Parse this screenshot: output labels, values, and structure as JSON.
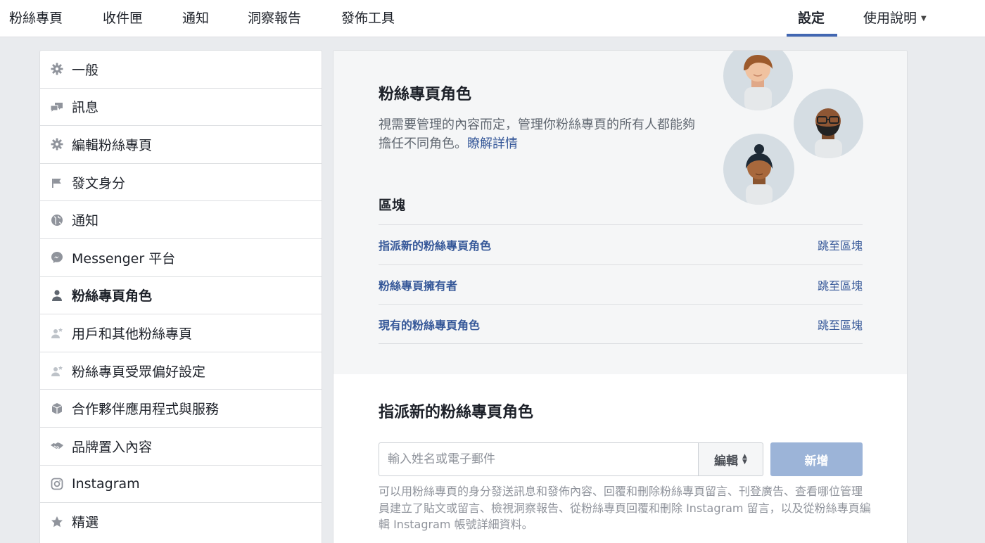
{
  "topnav": {
    "tabs": [
      "粉絲專頁",
      "收件匣",
      "通知",
      "洞察報告",
      "發佈工具"
    ],
    "settings": "設定",
    "help": "使用說明",
    "accent": "#4267b2"
  },
  "sidebar": {
    "items": [
      {
        "label": "一般",
        "icon": "gear-icon"
      },
      {
        "label": "訊息",
        "icon": "chat-bubbles-icon"
      },
      {
        "label": "編輯粉絲專頁",
        "icon": "gear-icon"
      },
      {
        "label": "發文身分",
        "icon": "flag-icon"
      },
      {
        "label": "通知",
        "icon": "globe-icon"
      },
      {
        "label": "Messenger 平台",
        "icon": "messenger-icon"
      },
      {
        "label": "粉絲專頁角色",
        "icon": "person-icon",
        "active": true
      },
      {
        "label": "用戶和其他粉絲專頁",
        "icon": "person-star-icon"
      },
      {
        "label": "粉絲專頁受眾偏好設定",
        "icon": "person-star-icon"
      },
      {
        "label": "合作夥伴應用程式與服務",
        "icon": "cube-icon"
      },
      {
        "label": "品牌置入內容",
        "icon": "handshake-icon"
      },
      {
        "label": "Instagram",
        "icon": "instagram-icon"
      },
      {
        "label": "精選",
        "icon": "star-icon"
      }
    ]
  },
  "hero": {
    "title": "粉絲專頁角色",
    "desc": "視需要管理的內容而定，管理你粉絲專頁的所有人都能夠擔任不同角色。",
    "link": "瞭解詳情"
  },
  "blocks": {
    "heading": "區塊",
    "rows": [
      {
        "name": "指派新的粉絲專頁角色",
        "jump": "跳至區塊"
      },
      {
        "name": "粉絲專頁擁有者",
        "jump": "跳至區塊"
      },
      {
        "name": "現有的粉絲專頁角色",
        "jump": "跳至區塊"
      }
    ]
  },
  "assign": {
    "title": "指派新的粉絲專頁角色",
    "placeholder": "輸入姓名或電子郵件",
    "role": "編輯",
    "add": "新增",
    "help": "可以用粉絲專頁的身分發送訊息和發佈內容、回覆和刪除粉絲專頁留言、刊登廣告、查看哪位管理員建立了貼文或留言、檢視洞察報告、從粉絲專頁回覆和刪除 Instagram 留言，以及從粉絲專頁編輯 Instagram 帳號詳細資料。"
  }
}
